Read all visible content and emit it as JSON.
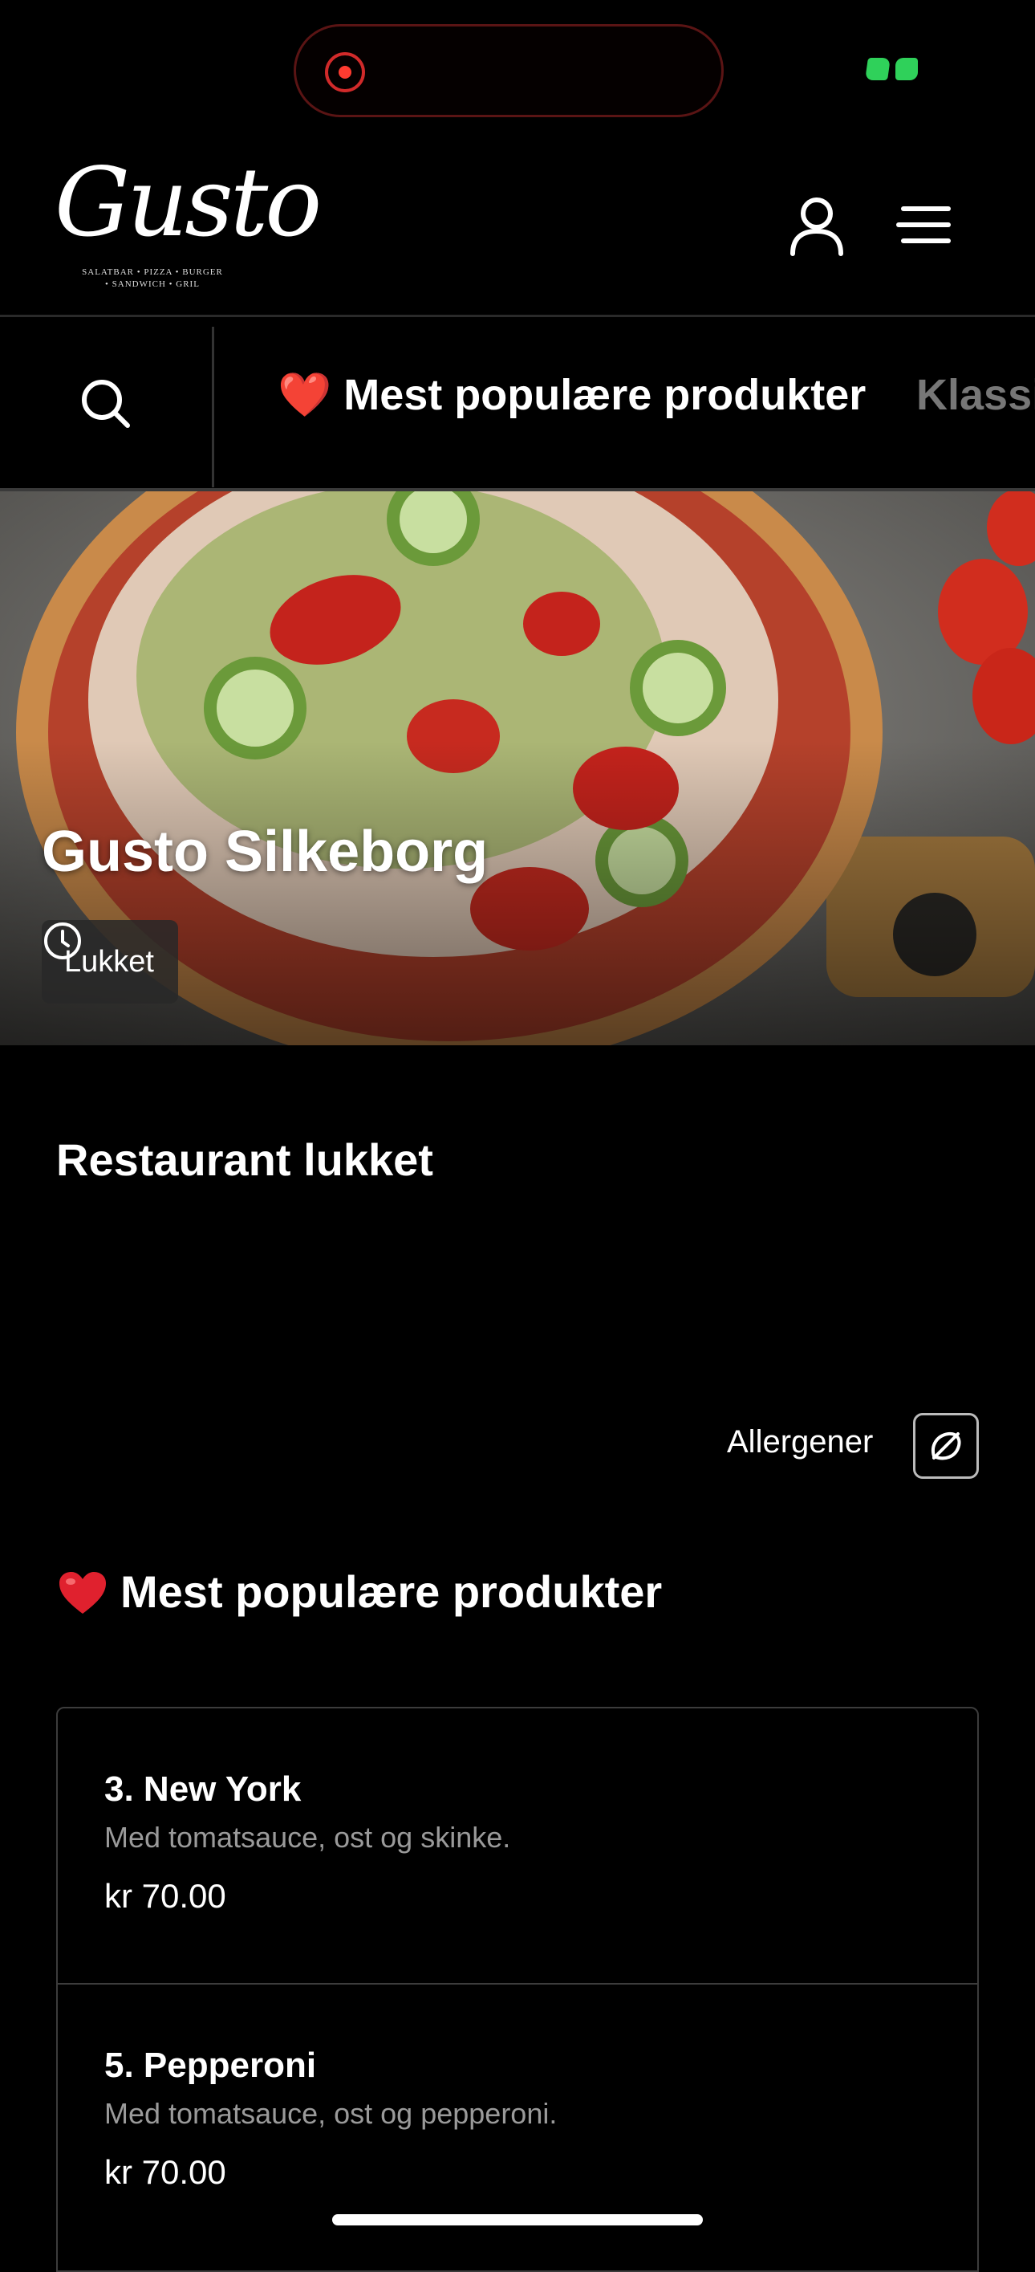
{
  "brand": {
    "logo_text": "Gusto",
    "logo_tagline_1": "SALATBAR • PIZZA • BURGER",
    "logo_tagline_2": "• SANDWICH • GRIL"
  },
  "categories": [
    {
      "label": "❤️ Mest populære produkter",
      "active": true
    },
    {
      "label": "Klassi",
      "active": false
    }
  ],
  "hero": {
    "title": "Gusto Silkeborg",
    "status": "Lukket"
  },
  "notice": {
    "title": "Restaurant lukket"
  },
  "allergens": {
    "label": "Allergener"
  },
  "section": {
    "title": "Mest populære produkter"
  },
  "products": [
    {
      "name": "3. New York",
      "description": "Med tomatsauce, ost og skinke.",
      "price": "kr 70.00"
    },
    {
      "name": "5. Pepperoni",
      "description": "Med tomatsauce, ost og pepperoni.",
      "price": "kr 70.00"
    }
  ],
  "colors": {
    "background": "#000000",
    "accent_green": "#2fd15a",
    "record_red": "#ff3b30",
    "heart_red": "#e0212e"
  },
  "icons": [
    "record-icon",
    "status-indicator-icon",
    "user-icon",
    "menu-icon",
    "search-icon",
    "heart-icon",
    "clock-icon",
    "allergen-icon"
  ]
}
